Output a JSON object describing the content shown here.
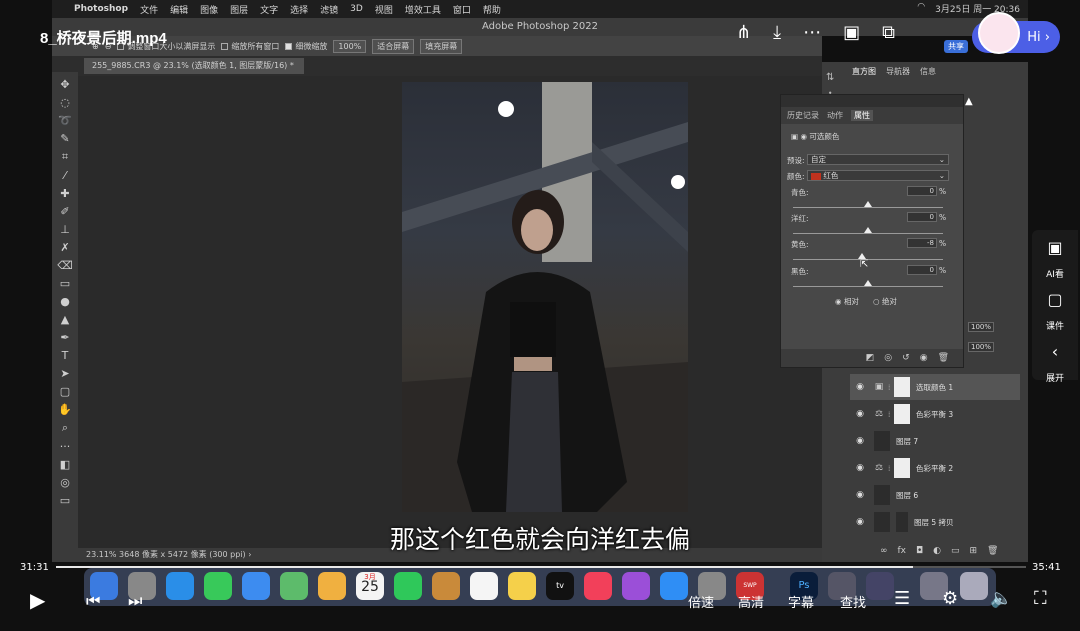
{
  "video": {
    "title": "8_桥夜景后期.mp4",
    "time_current": "31:31",
    "time_total": "35:41",
    "progress": 0.883
  },
  "menubar": {
    "apple": "",
    "app": "Photoshop",
    "items": [
      "文件",
      "编辑",
      "图像",
      "图层",
      "文字",
      "选择",
      "滤镜",
      "3D",
      "视图",
      "增效工具",
      "窗口",
      "帮助"
    ],
    "clock": "3月25日 周一 20:36"
  },
  "ps": {
    "window_title": "Adobe Photoshop 2022",
    "options": {
      "resize_label": "调整窗口大小以满屏显示",
      "zoom_all_label": "缩放所有窗口",
      "scrubby_label": "细微缩放",
      "zoom_value": "100%",
      "fit_label": "适合屏幕",
      "fill_label": "填充屏幕"
    },
    "doc_tab": "255_9885.CR3 @ 23.1% (选取颜色 1, 图层蒙版/16) *",
    "status": "23.11%   3648 像素 x 5472 像素 (300 ppi)   ›"
  },
  "overlay": {
    "hi": "Hi",
    "share": "共享"
  },
  "panels": {
    "top_tabs": [
      "直方图",
      "导航器",
      "信息"
    ],
    "props_tabs": [
      "历史记录",
      "动作",
      "属性"
    ],
    "props_title": "可选颜色",
    "preset_label": "预设:",
    "preset_value": "自定",
    "color_label": "颜色:",
    "color_value": "红色",
    "sliders": [
      {
        "label": "青色:",
        "value": "0",
        "unit": "%"
      },
      {
        "label": "洋红:",
        "value": "0",
        "unit": "%"
      },
      {
        "label": "黄色:",
        "value": "-8",
        "unit": "%"
      },
      {
        "label": "黑色:",
        "value": "0",
        "unit": "%"
      }
    ],
    "method_relative": "相对",
    "method_absolute": "绝对",
    "opacity": "100%",
    "fill": "100%"
  },
  "layers": [
    {
      "name": "选取颜色 1",
      "type": "adj-selective",
      "selected": true
    },
    {
      "name": "色彩平衡 3",
      "type": "adj-balance",
      "selected": false
    },
    {
      "name": "图层 7",
      "type": "pixel",
      "selected": false
    },
    {
      "name": "色彩平衡 2",
      "type": "adj-balance",
      "selected": false
    },
    {
      "name": "图层 6",
      "type": "pixel",
      "selected": false
    },
    {
      "name": "图层 5 拷贝",
      "type": "pixel-mask",
      "selected": false
    }
  ],
  "side_float": {
    "ai": "AI看",
    "courseware": "课件",
    "expand": "展开"
  },
  "subtitle": "那这个红色就会向洋红去偏",
  "player": {
    "speed": "倍速",
    "quality": "高清",
    "captions": "字幕",
    "search": "查找"
  },
  "dock": {
    "calendar_month": "3月",
    "calendar_day": "25",
    "swp": "SWP"
  }
}
